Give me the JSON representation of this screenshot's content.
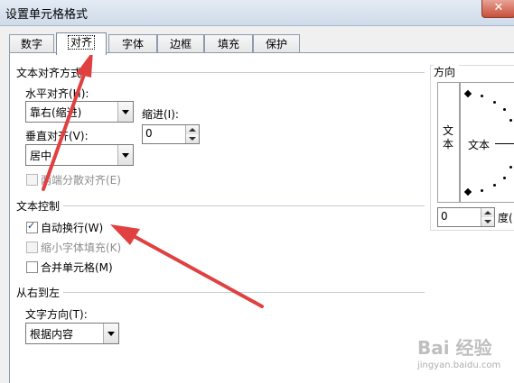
{
  "window": {
    "title": "设置单元格格式",
    "close_label": "✕"
  },
  "tabs": [
    {
      "label": "数字"
    },
    {
      "label": "对齐"
    },
    {
      "label": "字体"
    },
    {
      "label": "边框"
    },
    {
      "label": "填充"
    },
    {
      "label": "保护"
    }
  ],
  "text_alignment": {
    "group_title": "文本对齐方式",
    "horizontal_label": "水平对齐(H):",
    "horizontal_value": "靠右(缩进)",
    "indent_label": "缩进(I):",
    "indent_value": "0",
    "vertical_label": "垂直对齐(V):",
    "vertical_value": "居中",
    "justify_distributed_label": "两端分散对齐(E)"
  },
  "text_control": {
    "group_title": "文本控制",
    "wrap_text_label": "自动换行(W)",
    "wrap_text_checked": true,
    "shrink_to_fit_label": "缩小字体填充(K)",
    "merge_cells_label": "合并单元格(M)"
  },
  "rtl": {
    "group_title": "从右到左",
    "direction_label": "文字方向(T):",
    "direction_value": "根据内容"
  },
  "orientation": {
    "group_title": "方向",
    "vertical_text": "文本",
    "horizontal_text": "文本",
    "degree_value": "0",
    "degree_label": "度("
  },
  "watermark": {
    "brand": "Bai 经验",
    "url": "jingyan.baidu.com"
  },
  "colors": {
    "arrow": "#e04040",
    "tab_border": "#8c9cb0"
  }
}
